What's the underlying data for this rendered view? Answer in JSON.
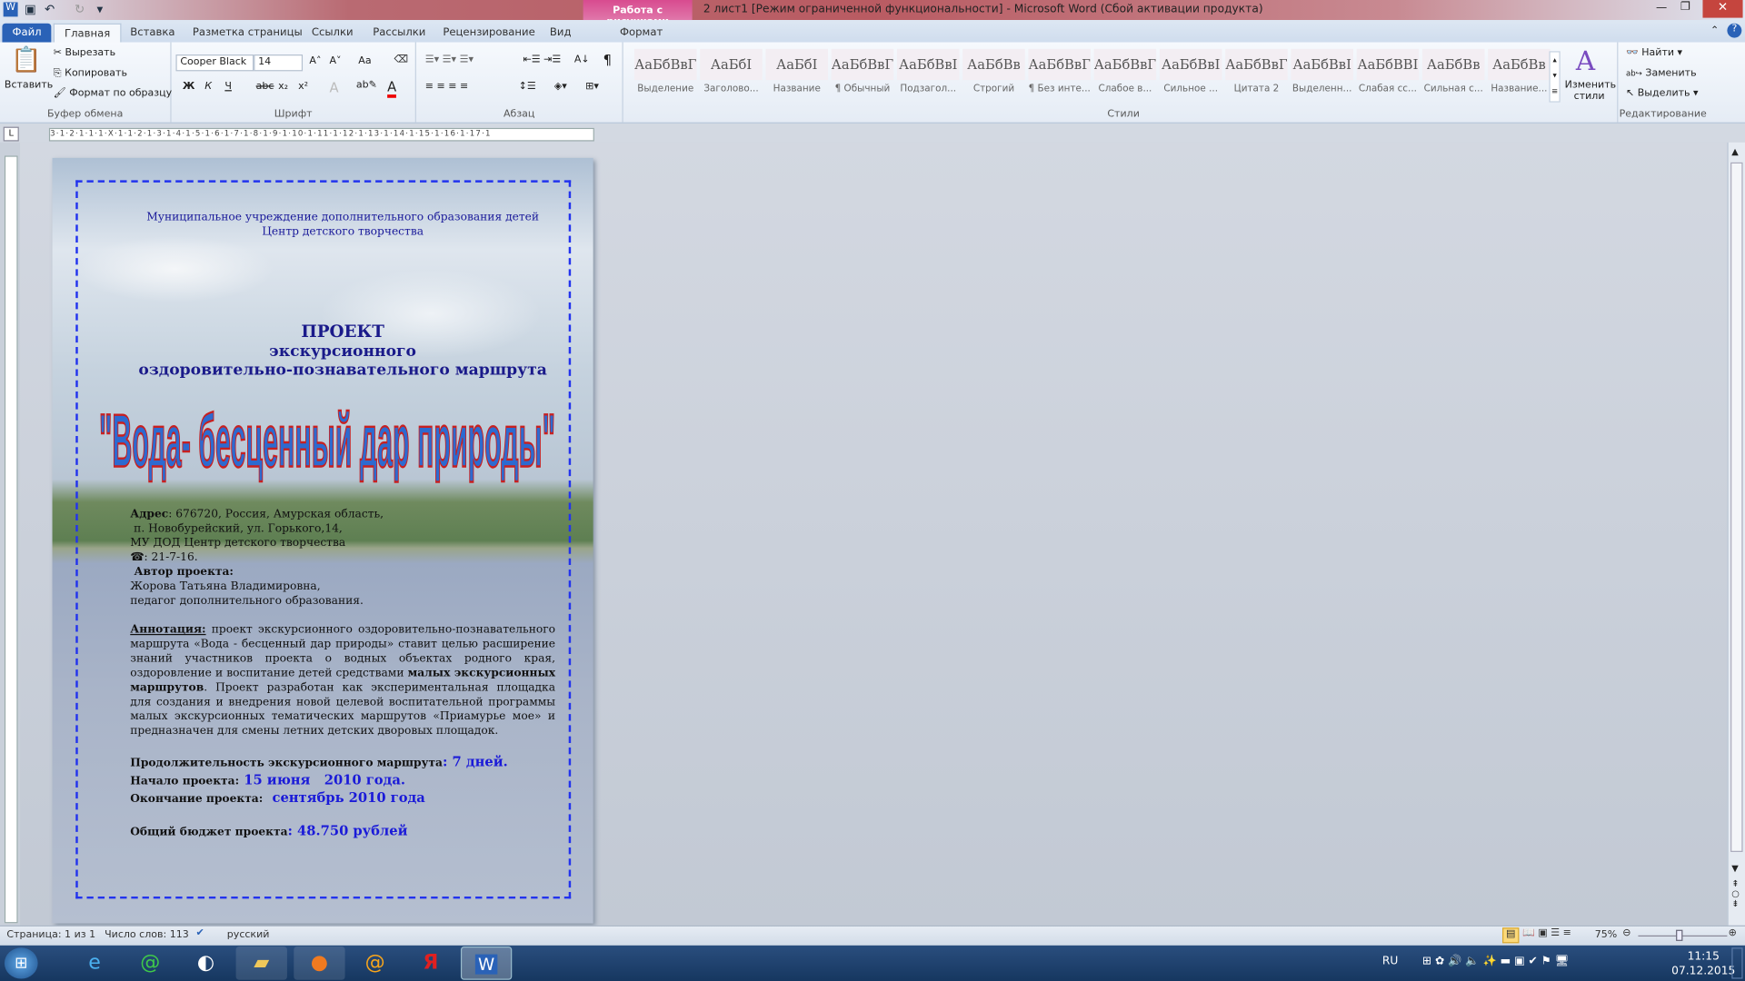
{
  "window": {
    "title": "2 лист1 [Режим ограниченной функциональности] - Microsoft Word (Сбой активации продукта)",
    "context_tab_group": "Работа с рисунками"
  },
  "tabs": [
    "Файл",
    "Главная",
    "Вставка",
    "Разметка страницы",
    "Ссылки",
    "Рассылки",
    "Рецензирование",
    "Вид",
    "Формат"
  ],
  "clipboard": {
    "paste": "Вставить",
    "cut": "Вырезать",
    "copy": "Копировать",
    "format_painter": "Формат по образцу",
    "label": "Буфер обмена"
  },
  "font": {
    "name": "Cooper Black",
    "size": "14",
    "label": "Шрифт",
    "bold": "Ж",
    "italic": "К",
    "underline": "Ч",
    "strike": "abc",
    "sub": "x₂",
    "sup": "x²",
    "grow": "A˄",
    "shrink": "A˅",
    "case": "Aa"
  },
  "paragraph": {
    "label": "Абзац"
  },
  "styles": {
    "label": "Стили",
    "change": "Изменить стили",
    "items": [
      {
        "sample": "АаБбВвГ",
        "name": "Выделение"
      },
      {
        "sample": "АаБбI",
        "name": "Заголово..."
      },
      {
        "sample": "АаБбI",
        "name": "Название"
      },
      {
        "sample": "АаБбВвГ",
        "name": "¶ Обычный"
      },
      {
        "sample": "АаБбВвI",
        "name": "Подзагол..."
      },
      {
        "sample": "АаБбВв",
        "name": "Строгий"
      },
      {
        "sample": "АаБбВвГ",
        "name": "¶ Без инте..."
      },
      {
        "sample": "АаБбВвГ",
        "name": "Слабое в..."
      },
      {
        "sample": "АаБбВвІ",
        "name": "Сильное ..."
      },
      {
        "sample": "АаБбВвГ",
        "name": "Цитата 2"
      },
      {
        "sample": "АаБбВвІ",
        "name": "Выделенн..."
      },
      {
        "sample": "АаБбВВІ",
        "name": "Слабая сс..."
      },
      {
        "sample": "АаБбВв",
        "name": "Сильная с..."
      },
      {
        "sample": "АаБбВв",
        "name": "Название..."
      }
    ]
  },
  "editing": {
    "find": "Найти",
    "replace": "Заменить",
    "select": "Выделить",
    "label": "Редактирование"
  },
  "ruler": "3·1·2·1·1·1·X·1·1·2·1·3·1·4·1·5·1·6·1·7·1·8·1·9·1·10·1·11·1·12·1·13·1·14·1·15·1·16·1·17·1",
  "document": {
    "org_line1": "Муниципальное  учреждение дополнительного образования детей",
    "org_line2": "Центр детского творчества",
    "heading1": "ПРОЕКТ",
    "heading2": "экскурсионного",
    "heading3": "оздоровительно-познавательного маршрута",
    "wordart": "\"Вода- бесценный дар природы\"",
    "address_label": "Адрес",
    "address1": ": 676720, Россия, Амурская область,",
    "address2": " п. Новобурейский, ул. Горького,14,",
    "address3": "МУ ДОД Центр детского творчества",
    "phone": "☎: 21-7-16.",
    "author_label": " Автор проекта:",
    "author_name": "Жорова Татьяна Владимировна,",
    "author_role": "педагог дополнительного образования.",
    "annotation_label": "Аннотация:",
    "annotation_text1": " проект экскурсионного оздоровительно-познавательного маршрута «Вода - бесценный дар природы» ставит целью расширение знаний участников  проекта о водных объектах родного края, оздоровление и  воспитание детей  средствами ",
    "annotation_bold": "малых экскурсионных маршрутов",
    "annotation_text2": ". Проект разработан как экспериментальная площадка  для создания и  внедрения новой целевой воспитательной программы малых экскурсионных тематических маршрутов «Приамурье мое» и  предназначен  для смены  летних детских дворовых площадок.",
    "duration_label": "Продолжительность  экскурсионного маршрута",
    "duration_value": ": 7 дней.",
    "start_label": "Начало проекта:",
    "start_value": " 15 июня   2010 года.",
    "end_label": "Окончание проекта:",
    "end_value": "  сентябрь 2010 года",
    "budget_label": "Общий бюджет проекта",
    "budget_value": ": 48.750 рублей"
  },
  "status": {
    "page": "Страница: 1 из 1",
    "words": "Число слов: 113",
    "language": "русский",
    "zoom": "75%",
    "zoom_level": 75
  },
  "taskbar": {
    "lang": "RU",
    "time": "11:15",
    "date": "07.12.2015"
  },
  "colors": {
    "accent_blue": "#1a1ad8",
    "context_tab": "#d84b8f",
    "file_tab": "#2a62b7",
    "taskbar": "#1f4370"
  }
}
